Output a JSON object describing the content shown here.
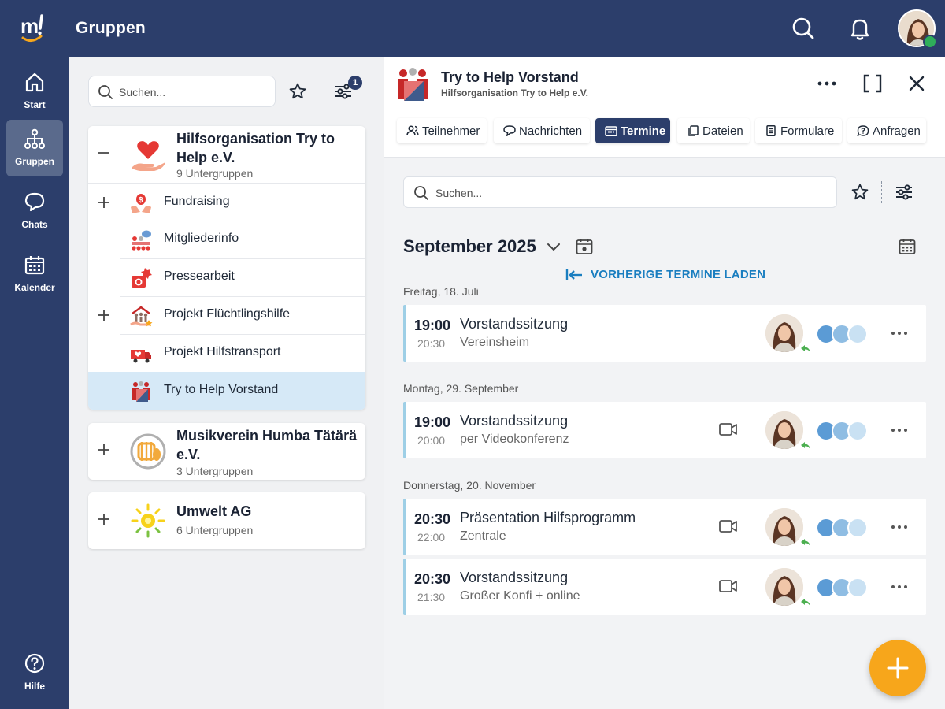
{
  "app": {
    "title": "Gruppen"
  },
  "colors": {
    "primary": "#2c3e6b",
    "accent": "#f7a61b",
    "link": "#1a7ec0",
    "selected_row": "#d6e9f7",
    "event_border": "#9ecfe6",
    "online_badge": "#2fae5a"
  },
  "topbar": {
    "icons": [
      "search-icon",
      "bell-icon"
    ],
    "avatar": "user-avatar"
  },
  "nav": {
    "items": [
      {
        "label": "Start",
        "icon": "home-icon"
      },
      {
        "label": "Gruppen",
        "icon": "org-tree-icon",
        "active": true
      },
      {
        "label": "Chats",
        "icon": "chat-bubble-icon"
      },
      {
        "label": "Kalender",
        "icon": "calendar-icon"
      }
    ],
    "help": {
      "label": "Hilfe",
      "icon": "help-circle-icon"
    }
  },
  "groups_panel": {
    "search_placeholder": "Suchen...",
    "filter_count": "1",
    "orgs": [
      {
        "name": "Hilfsorganisation Try to Help e.V.",
        "subtitle": "9 Untergruppen",
        "expanded": true,
        "subgroups": [
          {
            "label": "Fundraising",
            "expandable": true
          },
          {
            "label": "Mitgliederinfo",
            "expandable": false
          },
          {
            "label": "Pressearbeit",
            "expandable": false
          },
          {
            "label": "Projekt Flüchtlingshilfe",
            "expandable": true
          },
          {
            "label": "Projekt Hilfstransport",
            "expandable": false
          },
          {
            "label": "Try to Help Vorstand",
            "expandable": false,
            "selected": true
          }
        ]
      },
      {
        "name": "Musikverein Humba Tätärä e.V.",
        "subtitle": "3 Untergruppen",
        "expanded": false
      },
      {
        "name": "Umwelt AG",
        "subtitle": "6 Untergruppen",
        "expanded": false
      }
    ]
  },
  "detail": {
    "title": "Try to Help Vorstand",
    "subtitle": "Hilfsorganisation Try to Help e.V.",
    "tabs": [
      {
        "label": "Teilnehmer",
        "icon": "people-icon"
      },
      {
        "label": "Nachrichten",
        "icon": "message-icon"
      },
      {
        "label": "Termine",
        "icon": "calendar-icon",
        "active": true
      },
      {
        "label": "Dateien",
        "icon": "files-icon"
      },
      {
        "label": "Formulare",
        "icon": "form-icon"
      },
      {
        "label": "Anfragen",
        "icon": "question-icon"
      }
    ],
    "search_placeholder": "Suchen...",
    "month": "September 2025",
    "load_previous": "VORHERIGE TERMINE LADEN",
    "days": [
      {
        "label": "Freitag, 18. Juli",
        "events": [
          {
            "start": "19:00",
            "end": "20:30",
            "title": "Vorstandssitzung",
            "location": "Vereinsheim",
            "video": false
          }
        ]
      },
      {
        "label": "Montag, 29. September",
        "events": [
          {
            "start": "19:00",
            "end": "20:00",
            "title": "Vorstandssitzung",
            "location": "per Videokonferenz",
            "video": true
          }
        ]
      },
      {
        "label": "Donnerstag, 20. November",
        "events": [
          {
            "start": "20:30",
            "end": "22:00",
            "title": "Präsentation Hilfsprogramm",
            "location": "Zentrale",
            "video": true
          },
          {
            "start": "20:30",
            "end": "21:30",
            "title": "Vorstandssitzung",
            "location": "Großer Konfi + online",
            "video": true
          }
        ]
      }
    ]
  }
}
